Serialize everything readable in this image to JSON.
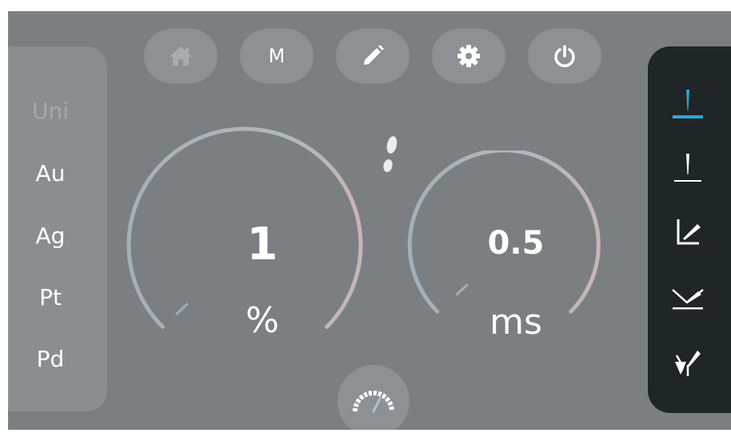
{
  "materials": {
    "selected": "Uni",
    "items": [
      {
        "label": "Uni"
      },
      {
        "label": "Au"
      },
      {
        "label": "Ag"
      },
      {
        "label": "Pt"
      },
      {
        "label": "Pd"
      }
    ]
  },
  "top_buttons": {
    "home_icon": "home-icon",
    "m_label": "M",
    "edit_icon": "pencil-icon",
    "settings_icon": "gear-icon",
    "power_icon": "power-icon"
  },
  "power_gauge": {
    "value": "1",
    "unit": "%",
    "fill_fraction": 0.01
  },
  "time_gauge": {
    "value": "0.5",
    "unit": "ms",
    "fill_fraction": 0.05
  },
  "foot_icon": "footprint-icon",
  "speed_icon": "speedometer-icon",
  "modes": {
    "selected_index": 0,
    "items": [
      {
        "icon": "point-weld-icon"
      },
      {
        "icon": "point-weld-alt-icon"
      },
      {
        "icon": "corner-weld-icon"
      },
      {
        "icon": "angled-seam-weld-icon"
      },
      {
        "icon": "jewel-setting-icon"
      }
    ]
  },
  "colors": {
    "background": "#7b7f82",
    "panel": "#8b8e91",
    "mode_panel": "#202527",
    "accent": "#29a8e0",
    "text": "#ffffff"
  }
}
